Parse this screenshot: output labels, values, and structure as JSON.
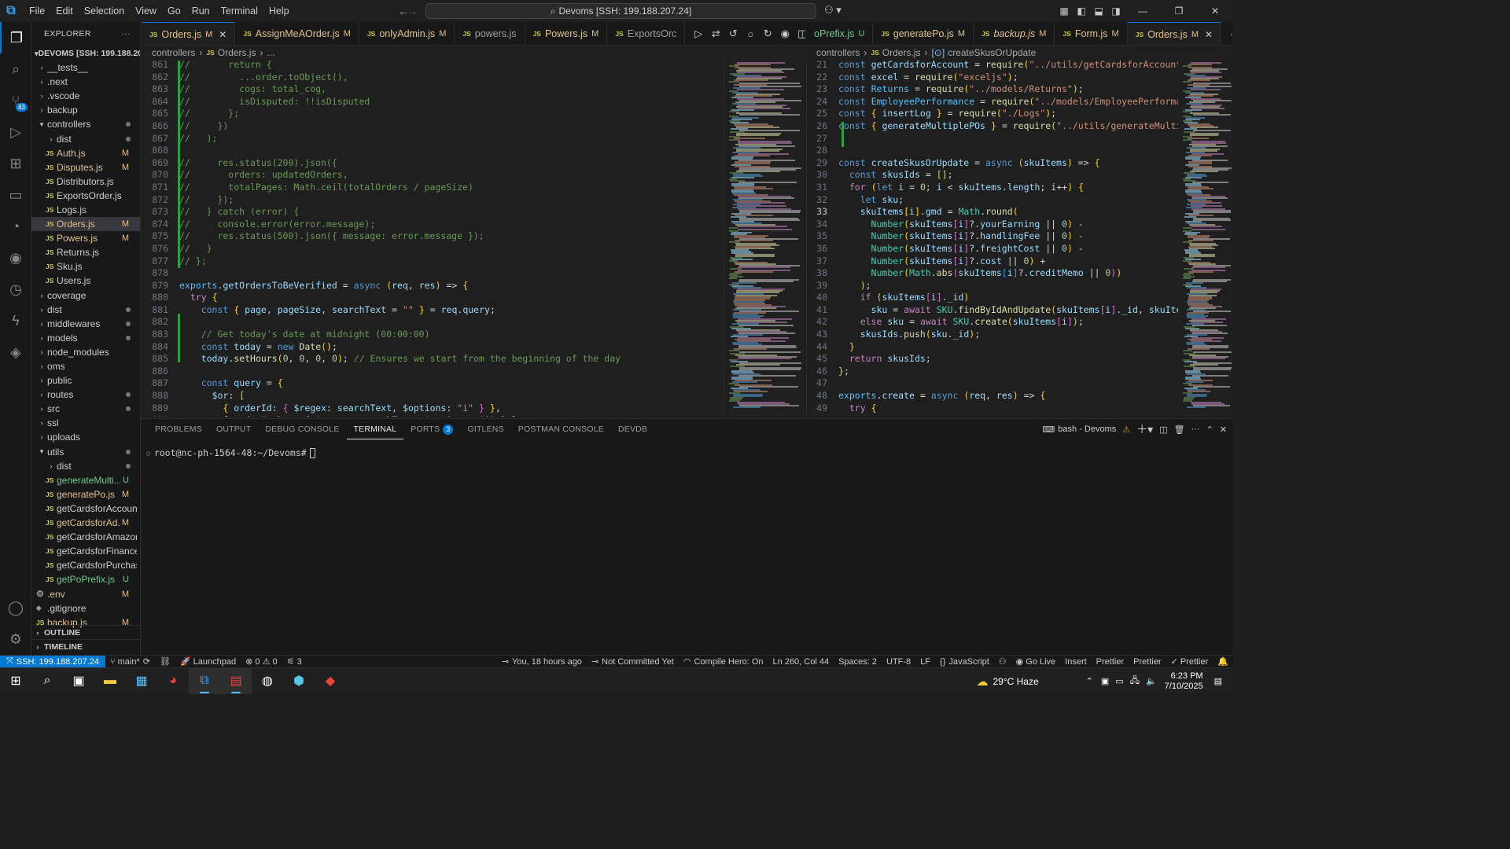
{
  "titlebar": {
    "menu": [
      "File",
      "Edit",
      "Selection",
      "View",
      "Go",
      "Run",
      "Terminal",
      "Help"
    ],
    "command_center": "Devoms [SSH: 199.188.207.24]"
  },
  "explorer": {
    "header": "EXPLORER",
    "root": "DEVOMS [SSH: 199.188.20...",
    "items": [
      {
        "name": "__tests__",
        "kind": "folder",
        "indent": 1,
        "open": false,
        "status": ""
      },
      {
        "name": ".next",
        "kind": "folder",
        "indent": 1,
        "open": false,
        "status": ""
      },
      {
        "name": ".vscode",
        "kind": "folder",
        "indent": 1,
        "open": false,
        "status": ""
      },
      {
        "name": "backup",
        "kind": "folder",
        "indent": 1,
        "open": false,
        "status": ""
      },
      {
        "name": "controllers",
        "kind": "folder",
        "indent": 1,
        "open": true,
        "status": "dot"
      },
      {
        "name": "dist",
        "kind": "folder",
        "indent": 2,
        "open": false,
        "status": "dot"
      },
      {
        "name": "Auth.js",
        "kind": "js",
        "indent": 2,
        "status": "M"
      },
      {
        "name": "Disputes.js",
        "kind": "js",
        "indent": 2,
        "status": "M"
      },
      {
        "name": "Distributors.js",
        "kind": "js",
        "indent": 2,
        "status": ""
      },
      {
        "name": "ExportsOrder.js",
        "kind": "js",
        "indent": 2,
        "status": ""
      },
      {
        "name": "Logs.js",
        "kind": "js",
        "indent": 2,
        "status": ""
      },
      {
        "name": "Orders.js",
        "kind": "js",
        "indent": 2,
        "status": "M",
        "selected": true
      },
      {
        "name": "Powers.js",
        "kind": "js",
        "indent": 2,
        "status": "M"
      },
      {
        "name": "Returns.js",
        "kind": "js",
        "indent": 2,
        "status": ""
      },
      {
        "name": "Sku.js",
        "kind": "js",
        "indent": 2,
        "status": ""
      },
      {
        "name": "Users.js",
        "kind": "js",
        "indent": 2,
        "status": ""
      },
      {
        "name": "coverage",
        "kind": "folder",
        "indent": 1,
        "open": false,
        "status": ""
      },
      {
        "name": "dist",
        "kind": "folder",
        "indent": 1,
        "open": false,
        "status": "dot"
      },
      {
        "name": "middlewares",
        "kind": "folder",
        "indent": 1,
        "open": false,
        "status": "dot"
      },
      {
        "name": "models",
        "kind": "folder",
        "indent": 1,
        "open": false,
        "status": "dot"
      },
      {
        "name": "node_modules",
        "kind": "folder",
        "indent": 1,
        "open": false,
        "status": ""
      },
      {
        "name": "oms",
        "kind": "folder",
        "indent": 1,
        "open": false,
        "status": ""
      },
      {
        "name": "public",
        "kind": "folder",
        "indent": 1,
        "open": false,
        "status": ""
      },
      {
        "name": "routes",
        "kind": "folder",
        "indent": 1,
        "open": false,
        "status": "dot"
      },
      {
        "name": "src",
        "kind": "folder",
        "indent": 1,
        "open": false,
        "status": "dot"
      },
      {
        "name": "ssl",
        "kind": "folder",
        "indent": 1,
        "open": false,
        "status": ""
      },
      {
        "name": "uploads",
        "kind": "folder",
        "indent": 1,
        "open": false,
        "status": ""
      },
      {
        "name": "utils",
        "kind": "folder",
        "indent": 1,
        "open": true,
        "status": "dot"
      },
      {
        "name": "dist",
        "kind": "folder",
        "indent": 2,
        "open": false,
        "status": "dot"
      },
      {
        "name": "generateMulti...",
        "kind": "js",
        "indent": 2,
        "status": "U"
      },
      {
        "name": "generatePo.js",
        "kind": "js",
        "indent": 2,
        "status": "M"
      },
      {
        "name": "getCardsforAccount.js",
        "kind": "js",
        "indent": 2,
        "status": ""
      },
      {
        "name": "getCardsforAd...",
        "kind": "js",
        "indent": 2,
        "status": "M"
      },
      {
        "name": "getCardsforAmazon.js",
        "kind": "js",
        "indent": 2,
        "status": ""
      },
      {
        "name": "getCardsforFinance.js",
        "kind": "js",
        "indent": 2,
        "status": ""
      },
      {
        "name": "getCardsforPurchasi...",
        "kind": "js",
        "indent": 2,
        "status": ""
      },
      {
        "name": "getPoPrefix.js",
        "kind": "js",
        "indent": 2,
        "status": "U"
      },
      {
        "name": ".env",
        "kind": "gear",
        "indent": 1,
        "status": "M"
      },
      {
        "name": ".gitignore",
        "kind": "plain",
        "indent": 1,
        "status": ""
      },
      {
        "name": "backup.js",
        "kind": "js",
        "indent": 1,
        "status": "M"
      }
    ],
    "outline": "OUTLINE",
    "timeline": "TIMELINE"
  },
  "tabs_left": [
    {
      "name": "Orders.js",
      "status": "M",
      "active": true
    },
    {
      "name": "AssignMeAOrder.js",
      "status": "M"
    },
    {
      "name": "onlyAdmin.js",
      "status": "M"
    },
    {
      "name": "powers.js",
      "status": ""
    },
    {
      "name": "Powers.js",
      "status": "M"
    },
    {
      "name": "ExportsOrc",
      "status": ""
    }
  ],
  "tabs_right": [
    {
      "name": "oPrefix.js",
      "status": "U",
      "noicon": true
    },
    {
      "name": "generatePo.js",
      "status": "M"
    },
    {
      "name": "backup.js",
      "status": "M",
      "italic": true
    },
    {
      "name": "Form.js",
      "status": "M"
    },
    {
      "name": "Orders.js",
      "status": "M",
      "active": true
    }
  ],
  "breadcrumb_left": [
    "controllers",
    "Orders.js",
    "..."
  ],
  "breadcrumb_right": [
    "controllers",
    "Orders.js",
    "createSkusOrUpdate"
  ],
  "editor_left": {
    "lines": [
      {
        "n": 861,
        "t": "//       return {"
      },
      {
        "n": 862,
        "t": "//         ...order.toObject(),"
      },
      {
        "n": 863,
        "t": "//         cogs: total_cog,"
      },
      {
        "n": 864,
        "t": "//         isDisputed: !!isDisputed"
      },
      {
        "n": 865,
        "t": "//       };"
      },
      {
        "n": 866,
        "t": "//     })"
      },
      {
        "n": 867,
        "t": "//   );"
      },
      {
        "n": 868,
        "t": ""
      },
      {
        "n": 869,
        "t": "//     res.status(200).json({"
      },
      {
        "n": 870,
        "t": "//       orders: updatedOrders,"
      },
      {
        "n": 871,
        "t": "//       totalPages: Math.ceil(totalOrders / pageSize)"
      },
      {
        "n": 872,
        "t": "//     });"
      },
      {
        "n": 873,
        "t": "//   } catch (error) {"
      },
      {
        "n": 874,
        "t": "//     console.error(error.message);"
      },
      {
        "n": 875,
        "t": "//     res.status(500).json({ message: error.message });"
      },
      {
        "n": 876,
        "t": "//   }"
      },
      {
        "n": 877,
        "t": "// };"
      },
      {
        "n": 878,
        "t": ""
      },
      {
        "n": 879,
        "t": "exports.getOrdersToBeVerified = async (req, res) => {"
      },
      {
        "n": 880,
        "t": "  try {"
      },
      {
        "n": 881,
        "t": "    const { page, pageSize, searchText = \"\" } = req.query;"
      },
      {
        "n": 882,
        "t": ""
      },
      {
        "n": 883,
        "t": "    // Get today's date at midnight (00:00:00)"
      },
      {
        "n": 884,
        "t": "    const today = new Date();"
      },
      {
        "n": 885,
        "t": "    today.setHours(0, 0, 0, 0); // Ensures we start from the beginning of the day"
      },
      {
        "n": 886,
        "t": ""
      },
      {
        "n": 887,
        "t": "    const query = {"
      },
      {
        "n": 888,
        "t": "      $or: ["
      },
      {
        "n": 889,
        "t": "        { orderId: { $regex: searchText, $options: \"i\" } },"
      },
      {
        "n": 890,
        "t": "        { orderNumber: { $regex: searchText, $options: \"i\" } },"
      }
    ]
  },
  "editor_right": {
    "lines": [
      {
        "n": 21,
        "t": "const getCardsforAccount = require(\"../utils/getCardsforAccount\");"
      },
      {
        "n": 22,
        "t": "const excel = require(\"exceljs\");"
      },
      {
        "n": 23,
        "t": "const Returns = require(\"../models/Returns\");"
      },
      {
        "n": 24,
        "t": "const EmployeePerformance = require(\"../models/EmployeePerformance\");"
      },
      {
        "n": 25,
        "t": "const { insertLog } = require(\"./Logs\");"
      },
      {
        "n": 26,
        "t": "const { generateMultiplePOs } = require(\"../utils/generateMultiplePOs\");"
      },
      {
        "n": 27,
        "t": ""
      },
      {
        "n": 28,
        "t": ""
      },
      {
        "n": 29,
        "t": "const createSkusOrUpdate = async (skuItems) => {"
      },
      {
        "n": 30,
        "t": "  const skusIds = [];"
      },
      {
        "n": 31,
        "t": "  for (let i = 0; i < skuItems.length; i++) {"
      },
      {
        "n": 32,
        "t": "    let sku;"
      },
      {
        "n": 33,
        "t": "    skuItems[i].gmd = Math.round("
      },
      {
        "n": 34,
        "t": "      Number(skuItems[i]?.yourEarning || 0) -"
      },
      {
        "n": 35,
        "t": "      Number(skuItems[i]?.handlingFee || 0) -"
      },
      {
        "n": 36,
        "t": "      Number(skuItems[i]?.freightCost || 0) -"
      },
      {
        "n": 37,
        "t": "      Number(skuItems[i]?.cost || 0) +"
      },
      {
        "n": 38,
        "t": "      Number(Math.abs(skuItems[i]?.creditMemo || 0))"
      },
      {
        "n": 39,
        "t": "    );"
      },
      {
        "n": 40,
        "t": "    if (skuItems[i]._id)"
      },
      {
        "n": 41,
        "t": "      sku = await SKU.findByIdAndUpdate(skuItems[i]._id, skuItems[i]);"
      },
      {
        "n": 42,
        "t": "    else sku = await SKU.create(skuItems[i]);"
      },
      {
        "n": 43,
        "t": "    skusIds.push(sku._id);"
      },
      {
        "n": 44,
        "t": "  }"
      },
      {
        "n": 45,
        "t": "  return skusIds;"
      },
      {
        "n": 46,
        "t": "};"
      },
      {
        "n": 47,
        "t": ""
      },
      {
        "n": 48,
        "t": "exports.create = async (req, res) => {"
      },
      {
        "n": 49,
        "t": "  try {"
      }
    ]
  },
  "panel": {
    "tabs": [
      "PROBLEMS",
      "OUTPUT",
      "DEBUG CONSOLE",
      "TERMINAL",
      "PORTS",
      "GITLENS",
      "POSTMAN CONSOLE",
      "DEVDB"
    ],
    "active_tab": "TERMINAL",
    "ports_badge": "3",
    "terminal_name": "bash - Devoms",
    "prompt": "root@nc-ph-1564-48:~/Devoms#"
  },
  "statusbar": {
    "remote": "SSH: 199.188.207.24",
    "branch": "main*",
    "launchpad": "Launchpad",
    "errors": "0",
    "warnings": "0",
    "ports": "3",
    "blame": "You, 18 hours ago",
    "commit": "Not Committed Yet",
    "compile_hero": "Compile Hero: On",
    "position": "Ln 260, Col 44",
    "spaces": "Spaces: 2",
    "encoding": "UTF-8",
    "eol": "LF",
    "language": "JavaScript",
    "golive": "Go Live",
    "insert": "Insert",
    "prettier1": "Prettier",
    "prettier2": "Prettier",
    "prettier3": "Prettier"
  },
  "taskbar": {
    "weather": "29°C  Haze",
    "time": "6:23 PM",
    "date": "7/10/2025"
  },
  "colors": {
    "accent": "#0078d4",
    "modified": "#e2c08d",
    "untracked": "#73c991",
    "comment": "#6a9955"
  }
}
